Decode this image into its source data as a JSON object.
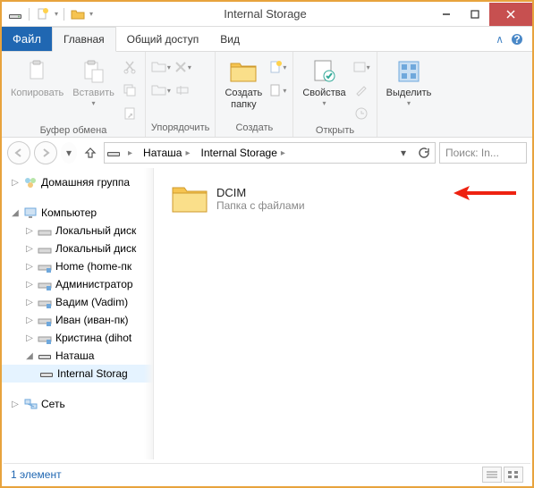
{
  "window": {
    "title": "Internal Storage"
  },
  "tabs": {
    "file": "Файл",
    "home": "Главная",
    "share": "Общий доступ",
    "view": "Вид"
  },
  "ribbon": {
    "clipboard": {
      "label": "Буфер обмена",
      "copy": "Копировать",
      "paste": "Вставить"
    },
    "organize": {
      "label": "Упорядочить"
    },
    "new": {
      "label": "Создать",
      "newfolder": "Создать\nпапку"
    },
    "open": {
      "label": "Открыть",
      "properties": "Свойства"
    },
    "select": {
      "label": "",
      "selectall": "Выделить"
    }
  },
  "address": {
    "crumb1": "Наташа",
    "crumb2": "Internal Storage"
  },
  "search": {
    "placeholder": "Поиск: In..."
  },
  "tree": {
    "homegroup": "Домашняя группа",
    "computer": "Компьютер",
    "localdisk1": "Локальный диск",
    "localdisk2": "Локальный диск",
    "home": "Home (home-пк",
    "admin": "Администратор",
    "vadim": "Вадим (Vadim)",
    "ivan": "Иван (иван-пк)",
    "kristina": "Кристина (dihot",
    "natasha": "Наташа",
    "internal": "Internal Storag",
    "network": "Сеть"
  },
  "content": {
    "folder": {
      "name": "DCIM",
      "subtitle": "Папка с файлами"
    }
  },
  "status": {
    "count": "1 элемент"
  }
}
